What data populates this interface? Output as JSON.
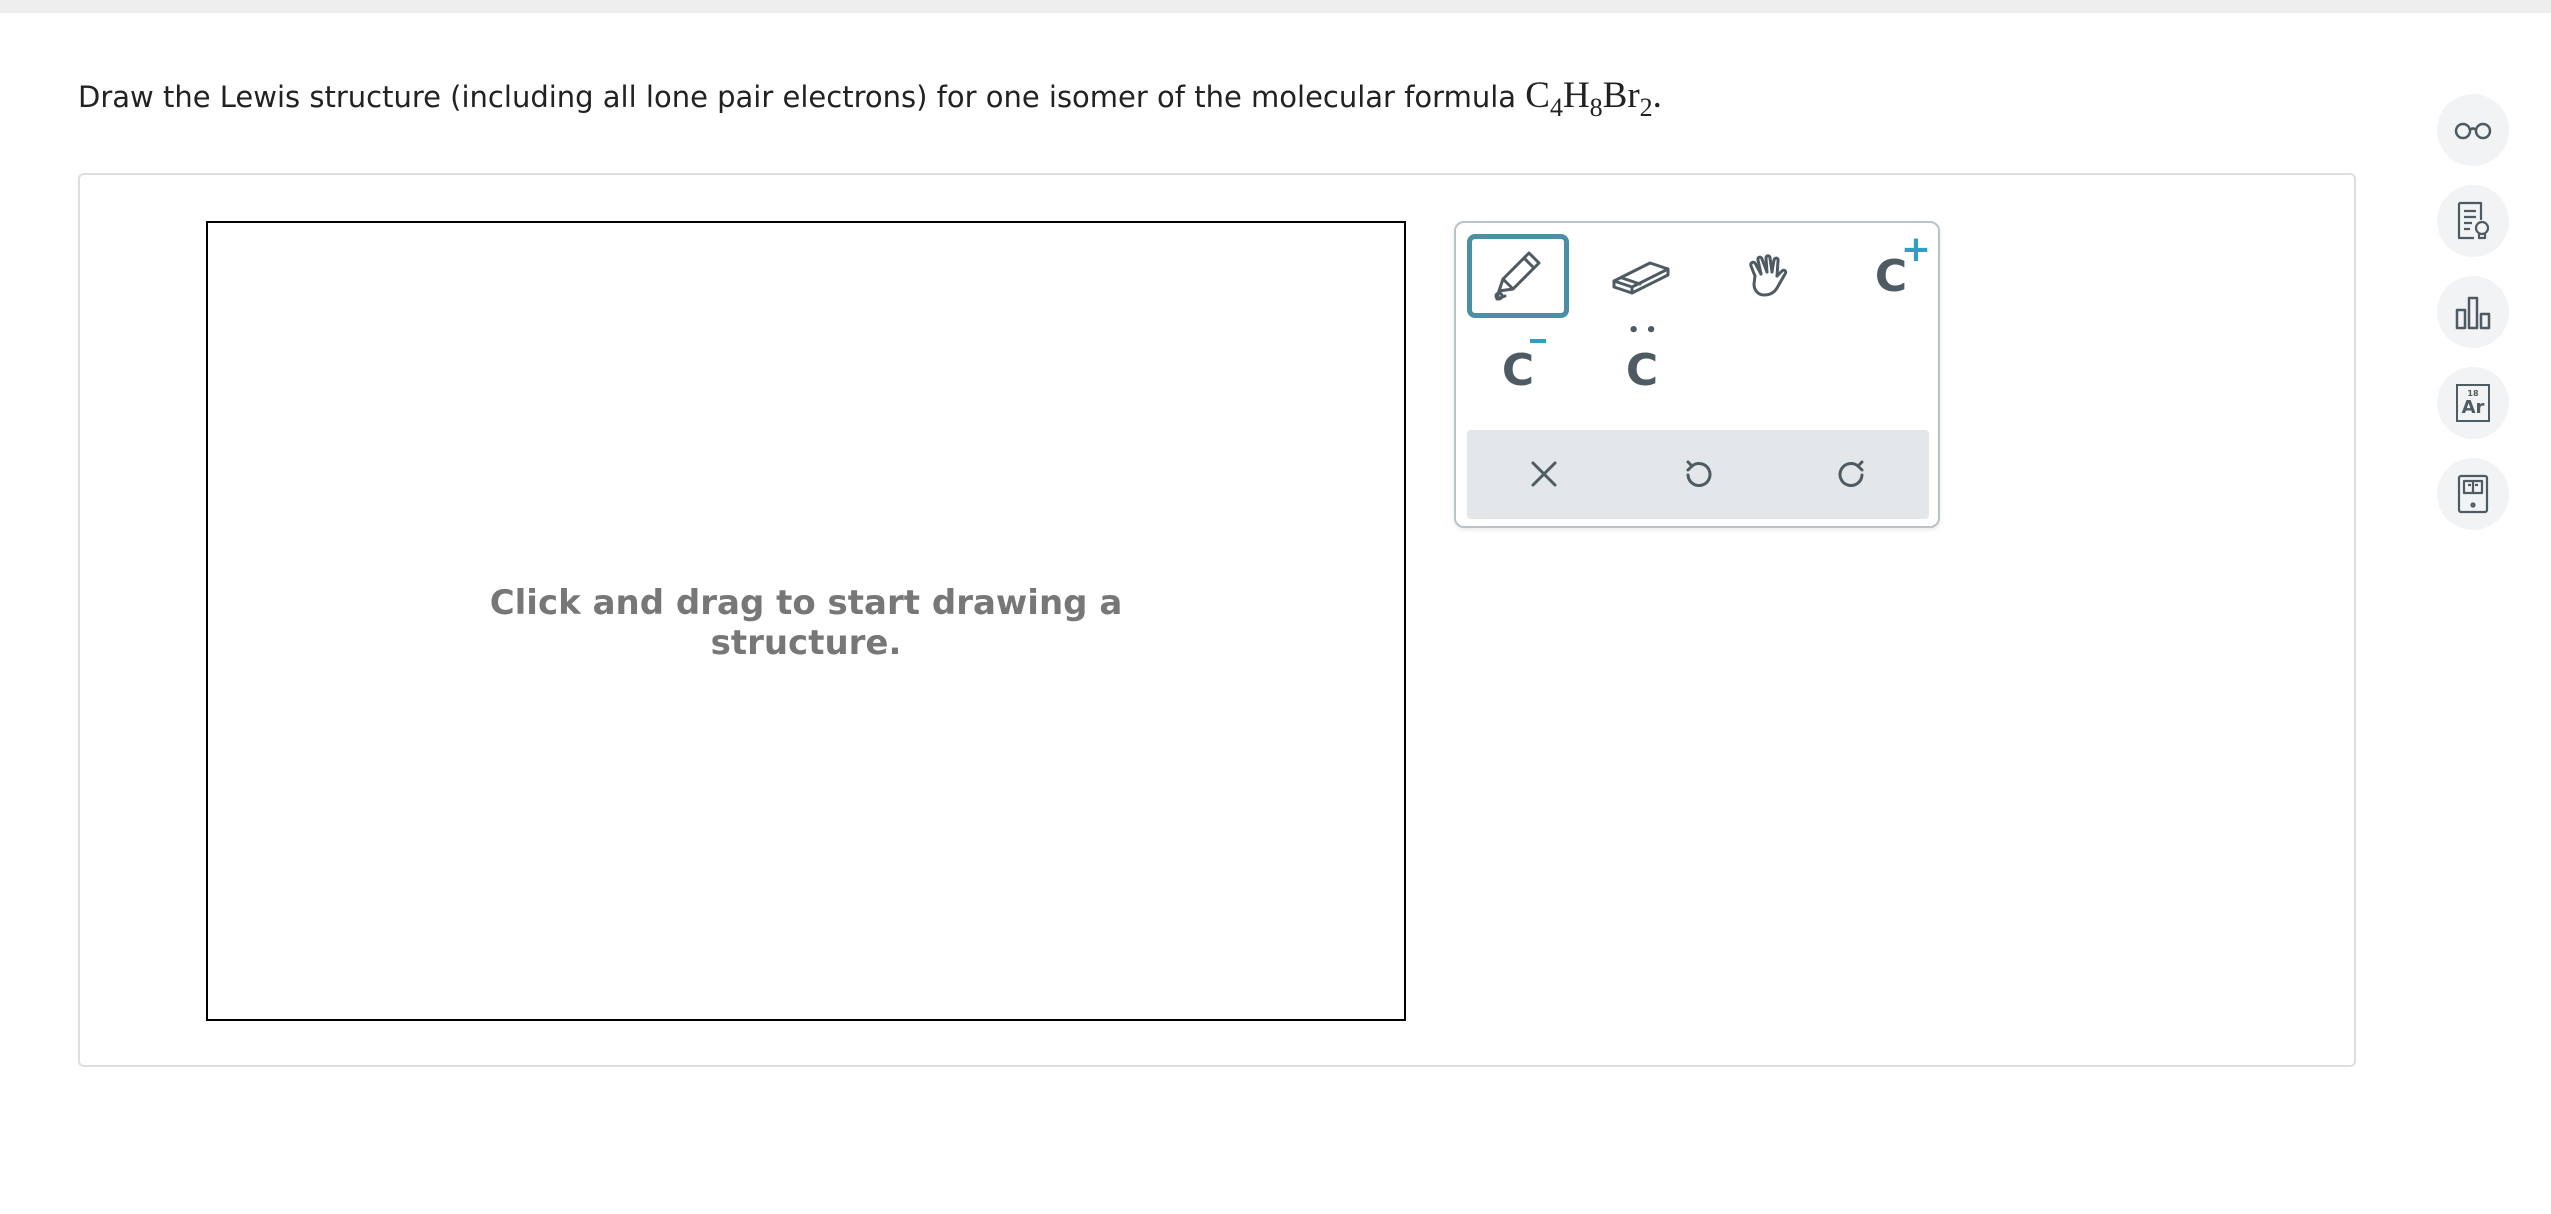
{
  "question": {
    "prefix": "Draw the Lewis structure (including all lone pair electrons) for one isomer of the molecular formula ",
    "formula": [
      {
        "el": "C",
        "sub": "4"
      },
      {
        "el": "H",
        "sub": "8"
      },
      {
        "el": "Br",
        "sub": "2"
      }
    ],
    "suffix": "."
  },
  "canvas": {
    "hint_line1": "Click and drag to start drawing a",
    "hint_line2": "structure."
  },
  "tools": [
    {
      "name": "pencil-tool",
      "icon": "pencil-icon",
      "active": true
    },
    {
      "name": "eraser-tool",
      "icon": "eraser-icon",
      "active": false
    },
    {
      "name": "hand-tool",
      "icon": "hand-icon",
      "active": false
    },
    {
      "name": "positive-charge-tool",
      "icon": "c-plus-icon",
      "label": "C",
      "sup": "+",
      "active": false
    },
    {
      "name": "negative-charge-tool",
      "icon": "c-minus-icon",
      "label": "C",
      "active": false
    },
    {
      "name": "lone-pair-tool",
      "icon": "c-lone-pair-icon",
      "label": "C",
      "dots": "••",
      "active": false
    }
  ],
  "actions": [
    {
      "name": "clear-button",
      "icon": "close-icon"
    },
    {
      "name": "undo-button",
      "icon": "undo-icon"
    },
    {
      "name": "redo-button",
      "icon": "redo-icon"
    }
  ],
  "sidebar": [
    {
      "name": "explanation-button",
      "icon": "glasses-icon"
    },
    {
      "name": "notes-button",
      "icon": "document-lightbulb-icon"
    },
    {
      "name": "data-button",
      "icon": "bar-chart-icon"
    },
    {
      "name": "periodic-table-button",
      "icon": "periodic-table-icon",
      "number": "18",
      "symbol": "Ar"
    },
    {
      "name": "calculator-button",
      "icon": "calculator-icon"
    }
  ],
  "colors": {
    "accent": "#4a8fa4",
    "icon": "#4f5b62",
    "charge": "#2e9ec1",
    "hint": "#777777"
  }
}
